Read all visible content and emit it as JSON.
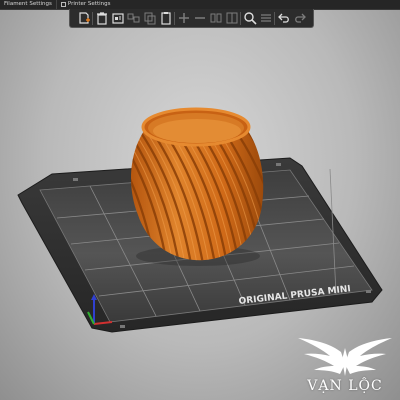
{
  "tabs": [
    {
      "label": "Filament Settings"
    },
    {
      "label": "Printer Settings"
    }
  ],
  "toolbar": {
    "buttons": [
      {
        "icon": "add-icon"
      },
      {
        "icon": "delete-icon"
      },
      {
        "icon": "delete-all-icon"
      },
      {
        "icon": "arrange-icon"
      },
      {
        "icon": "copy-icon"
      },
      {
        "icon": "paste-icon"
      },
      {
        "icon": "add-instance-icon"
      },
      {
        "icon": "remove-instance-icon"
      },
      {
        "icon": "split-objects-icon"
      },
      {
        "icon": "split-parts-icon"
      },
      {
        "icon": "search-icon"
      },
      {
        "icon": "layers-editing-icon"
      },
      {
        "icon": "undo-icon"
      },
      {
        "icon": "redo-icon"
      }
    ]
  },
  "bed": {
    "label": "ORIGINAL PRUSA MINI"
  },
  "model": {
    "color": "#d9721c"
  },
  "watermark": {
    "text": "VẠN LỘC"
  },
  "colors": {
    "ui_dark": "#2c2c2c",
    "bed_dark": "#2f2f2f",
    "grid_line": "#8a8a8a",
    "axis_x": "#d03030",
    "axis_y": "#30b030",
    "axis_z": "#3040d0"
  }
}
